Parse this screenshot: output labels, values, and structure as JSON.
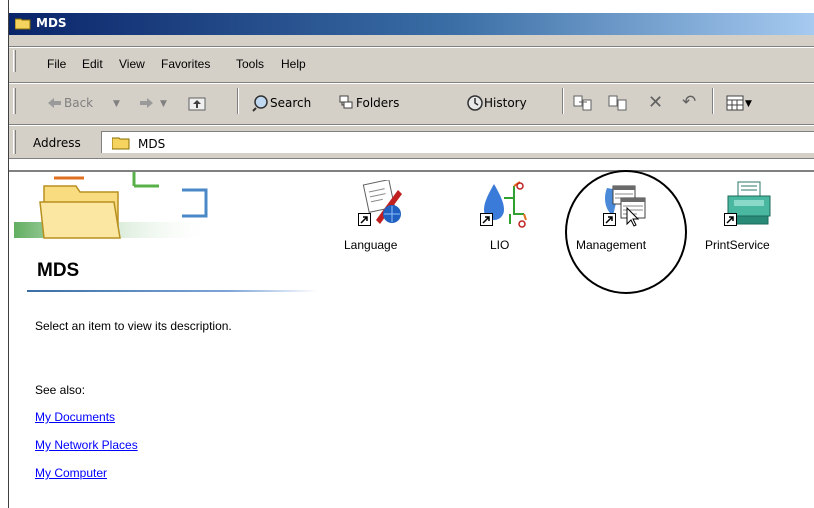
{
  "window": {
    "title": "MDS"
  },
  "menu": {
    "items": [
      "File",
      "Edit",
      "View",
      "Favorites",
      "Tools",
      "Help"
    ]
  },
  "toolbar": {
    "back": "Back",
    "search": "Search",
    "folders": "Folders",
    "history": "History"
  },
  "address": {
    "label": "Address",
    "value": "MDS"
  },
  "panel": {
    "title": "MDS",
    "description": "Select an item to view its description.",
    "see_also": "See also:",
    "links": [
      "My Documents",
      "My Network Places",
      "My Computer"
    ]
  },
  "files": [
    {
      "name": "Language",
      "icon": "language-shortcut-icon"
    },
    {
      "name": "LIO",
      "icon": "lio-shortcut-icon"
    },
    {
      "name": "Management",
      "icon": "management-shortcut-icon"
    },
    {
      "name": "PrintService",
      "icon": "printer-shortcut-icon"
    }
  ],
  "colors": {
    "titlebar": "#0a246a",
    "link": "#0000ff",
    "chrome": "#d4d0c8"
  }
}
